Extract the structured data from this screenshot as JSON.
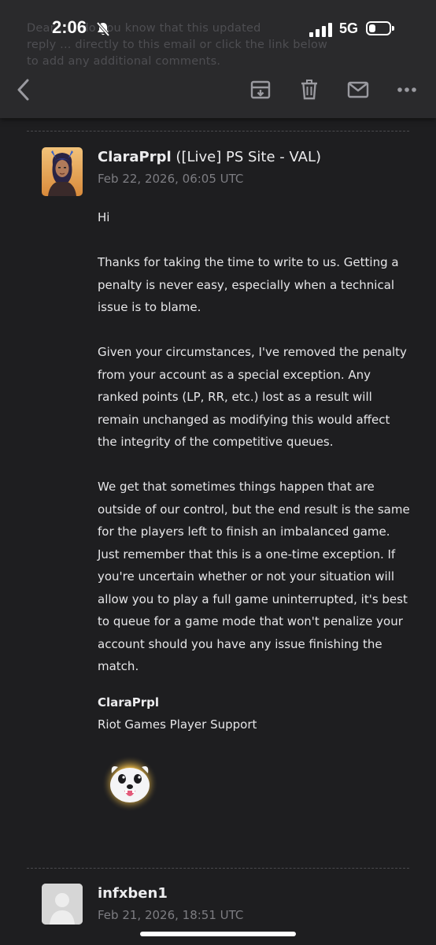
{
  "status_bar": {
    "time": "2:06",
    "network": "5G",
    "battery_level": 0.35
  },
  "background_text": {
    "lines": [
      "Dear ... , do you know that this updated",
      "reply ... directly to this email or click the link below",
      "to add any additional comments."
    ]
  },
  "toolbar": {
    "icons": [
      "chevron-left-icon",
      "archive-icon",
      "trash-icon",
      "mail-icon",
      "more-icon"
    ]
  },
  "message": {
    "sender_name": "ClaraPrpl",
    "sender_tag": "([Live] PS Site - VAL)",
    "date": "Feb 22, 2026, 06:05 UTC",
    "greeting": "Hi",
    "paragraphs": [
      "Thanks for taking the time to write to us. Getting a penalty is never easy, especially when a technical issue is to blame.",
      "Given your circumstances, I've removed the penalty from your account as a special exception. Any ranked points (LP, RR, etc.) lost as a result will remain unchanged as modifying this would affect the integrity of the competitive queues.",
      "We get that sometimes things happen that are outside of our control, but the end result is the same for the players left to finish an imbalanced game. Just remember that this is a one-time exception. If you're uncertain whether or not your situation will allow you to play a full game uninterrupted, it's best to queue for a game mode that won't penalize your account should you have any issue finishing the match."
    ],
    "signature_name": "ClaraPrpl",
    "signature_org": "Riot Games Player Support"
  },
  "next_message": {
    "sender_name": "infxben1",
    "date": "Feb 21, 2026, 18:51 UTC"
  }
}
